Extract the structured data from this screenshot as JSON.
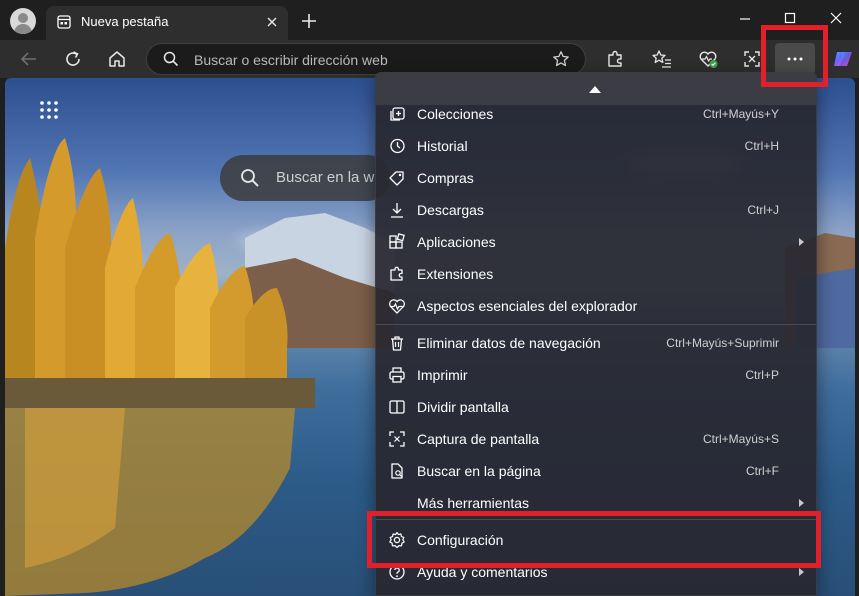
{
  "tab": {
    "title": "Nueva pestaña"
  },
  "address": {
    "placeholder": "Buscar o escribir dirección web"
  },
  "ntp": {
    "search_placeholder": "Buscar en la w"
  },
  "menu": {
    "items": [
      {
        "label": "Colecciones",
        "shortcut": "Ctrl+Mayús+Y",
        "icon": "collections-icon"
      },
      {
        "label": "Historial",
        "shortcut": "Ctrl+H",
        "icon": "history-icon"
      },
      {
        "label": "Compras",
        "shortcut": "",
        "icon": "tag-icon"
      },
      {
        "label": "Descargas",
        "shortcut": "Ctrl+J",
        "icon": "download-icon"
      },
      {
        "label": "Aplicaciones",
        "shortcut": "",
        "icon": "apps-icon"
      },
      {
        "label": "Extensiones",
        "shortcut": "",
        "icon": "puzzle-icon"
      },
      {
        "label": "Aspectos esenciales del explorador",
        "shortcut": "",
        "icon": "heart-pulse-icon"
      },
      {
        "label": "Eliminar datos de navegación",
        "shortcut": "Ctrl+Mayús+Suprimir",
        "icon": "trash-icon"
      },
      {
        "label": "Imprimir",
        "shortcut": "Ctrl+P",
        "icon": "printer-icon"
      },
      {
        "label": "Dividir pantalla",
        "shortcut": "",
        "icon": "split-screen-icon"
      },
      {
        "label": "Captura de pantalla",
        "shortcut": "Ctrl+Mayús+S",
        "icon": "screenshot-icon"
      },
      {
        "label": "Buscar en la página",
        "shortcut": "Ctrl+F",
        "icon": "find-icon"
      },
      {
        "label": "Más herramientas",
        "shortcut": "",
        "icon": ""
      },
      {
        "label": "Configuración",
        "shortcut": "",
        "icon": "gear-icon"
      },
      {
        "label": "Ayuda y comentarios",
        "shortcut": "",
        "icon": "help-icon"
      }
    ]
  },
  "colors": {
    "highlight": "#e0202a",
    "menu_bg": "#28282f",
    "toolbar_bg": "#2e2e2e",
    "titlebar_bg": "#1f1f1f"
  }
}
